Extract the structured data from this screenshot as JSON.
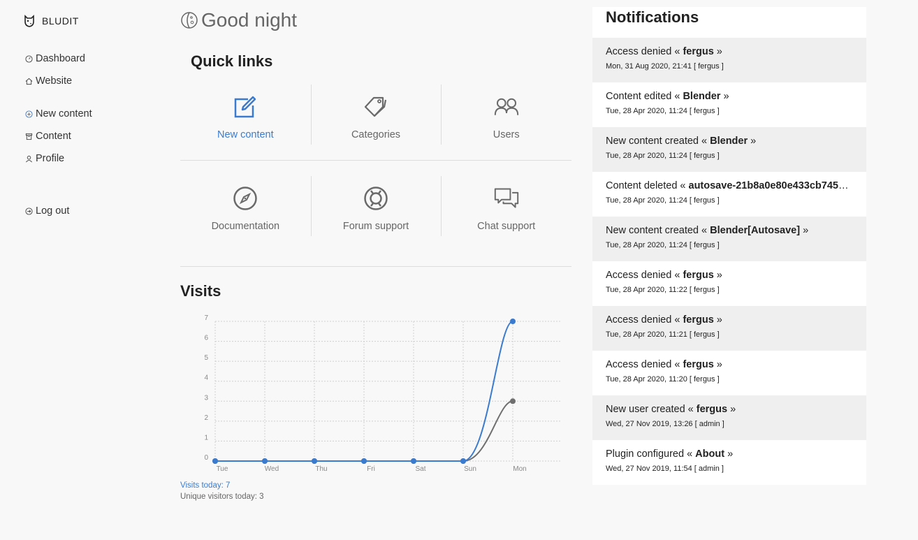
{
  "sidebar": {
    "brand": "BLUDIT",
    "items": [
      {
        "label": "Dashboard",
        "icon": "dashboard-icon"
      },
      {
        "label": "Website",
        "icon": "home-icon"
      },
      {
        "label": "New content",
        "icon": "plus-circle-icon"
      },
      {
        "label": "Content",
        "icon": "archive-icon"
      },
      {
        "label": "Profile",
        "icon": "user-icon"
      },
      {
        "label": "Log out",
        "icon": "logout-icon"
      }
    ]
  },
  "main": {
    "greeting": "Good night",
    "quick_links_title": "Quick links",
    "quick_links": [
      {
        "label": "New content",
        "icon": "edit-icon",
        "active": true
      },
      {
        "label": "Categories",
        "icon": "tag-icon"
      },
      {
        "label": "Users",
        "icon": "users-icon"
      },
      {
        "label": "Documentation",
        "icon": "compass-icon"
      },
      {
        "label": "Forum support",
        "icon": "lifebuoy-icon"
      },
      {
        "label": "Chat support",
        "icon": "chat-icon"
      }
    ],
    "visits_title": "Visits",
    "visits_today": "Visits today: 7",
    "unique_today": "Unique visitors today: 3"
  },
  "chart_data": {
    "type": "line",
    "categories": [
      "Tue",
      "Wed",
      "Thu",
      "Fri",
      "Sat",
      "Sun",
      "Mon"
    ],
    "series": [
      {
        "values": [
          0,
          0,
          0,
          0,
          0,
          0,
          7
        ],
        "color": "#3b7bcf"
      },
      {
        "values": [
          0,
          0,
          0,
          0,
          0,
          0,
          3
        ],
        "color": "#6f6f6f"
      }
    ],
    "ylim": [
      0,
      7
    ],
    "yticks": [
      0,
      1,
      2,
      3,
      4,
      5,
      6,
      7
    ],
    "grid": true
  },
  "notifications": {
    "title": "Notifications",
    "items": [
      {
        "pre": "Access denied «",
        "bold": "fergus",
        "post": "»",
        "meta": "Mon, 31 Aug 2020, 21:41 [ fergus ]"
      },
      {
        "pre": "Content edited «",
        "bold": "Blender",
        "post": "»",
        "meta": "Tue, 28 Apr 2020, 11:24 [ fergus ]"
      },
      {
        "pre": "New content created «",
        "bold": "Blender",
        "post": "»",
        "meta": "Tue, 28 Apr 2020, 11:24 [ fergus ]"
      },
      {
        "pre": "Content deleted «",
        "bold": "autosave-21b8a0e80e433cb7453…",
        "post": "",
        "meta": "Tue, 28 Apr 2020, 11:24 [ fergus ]"
      },
      {
        "pre": "New content created «",
        "bold": "Blender[Autosave]",
        "post": "»",
        "meta": "Tue, 28 Apr 2020, 11:24 [ fergus ]"
      },
      {
        "pre": "Access denied «",
        "bold": "fergus",
        "post": "»",
        "meta": "Tue, 28 Apr 2020, 11:22 [ fergus ]"
      },
      {
        "pre": "Access denied «",
        "bold": "fergus",
        "post": "»",
        "meta": "Tue, 28 Apr 2020, 11:21 [ fergus ]"
      },
      {
        "pre": "Access denied «",
        "bold": "fergus",
        "post": "»",
        "meta": "Tue, 28 Apr 2020, 11:20 [ fergus ]"
      },
      {
        "pre": "New user created «",
        "bold": "fergus",
        "post": "»",
        "meta": "Wed, 27 Nov 2019, 13:26 [ admin ]"
      },
      {
        "pre": "Plugin configured «",
        "bold": "About",
        "post": "»",
        "meta": "Wed, 27 Nov 2019, 11:54 [ admin ]"
      }
    ]
  }
}
